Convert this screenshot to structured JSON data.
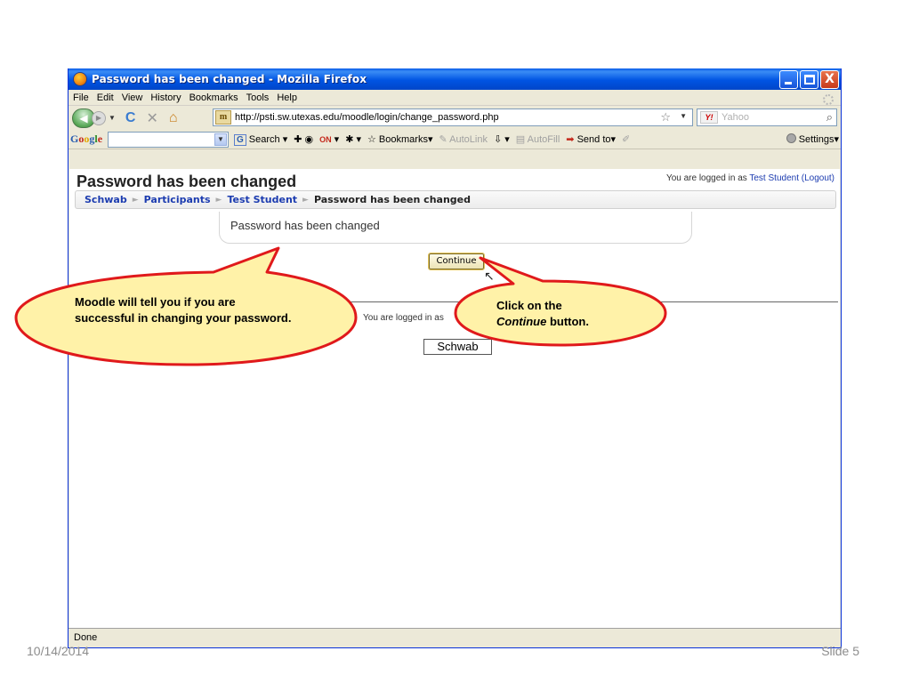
{
  "window": {
    "title": "Password has been changed - Mozilla Firefox",
    "min_label": "_",
    "close_label": "X"
  },
  "menu": [
    "File",
    "Edit",
    "View",
    "History",
    "Bookmarks",
    "Tools",
    "Help"
  ],
  "nav": {
    "url": "http://psti.sw.utexas.edu/moodle/login/change_password.php",
    "site_icon_text": "m",
    "search_engine": "Yahoo",
    "search_placeholder": "Yahoo"
  },
  "google_toolbar": {
    "logo": [
      "G",
      "o",
      "o",
      "g",
      "l",
      "e"
    ],
    "search_label": "Search",
    "bookmarks_label": "Bookmarks",
    "autolink_label": "AutoLink",
    "autofill_label": "AutoFill",
    "sendto_label": "Send to",
    "settings_label": "Settings",
    "on_badge": "ON"
  },
  "page": {
    "heading": "Password has been changed",
    "login_prefix": "You are logged in as",
    "user_name": "Test Student",
    "logout_label": "(Logout)",
    "breadcrumb": [
      "Schwab",
      "Participants",
      "Test Student",
      "Password has been changed"
    ],
    "notice": "Password has been changed",
    "continue_label": "Continue",
    "footer_login": "You are logged in as",
    "home_button": "Schwab"
  },
  "status": "Done",
  "callouts": {
    "left_text": "Moodle will tell you if you are successful in changing your password.",
    "right_line1": "Click on the",
    "right_italic": "Continue",
    "right_rest": " button."
  },
  "slide": {
    "date": "10/14/2014",
    "number": "Slide 5"
  },
  "colors": {
    "callout_fill": "#fff2a8",
    "callout_border": "#e0191b",
    "link": "#1c3cb0",
    "titlebar": "#0054e3"
  }
}
